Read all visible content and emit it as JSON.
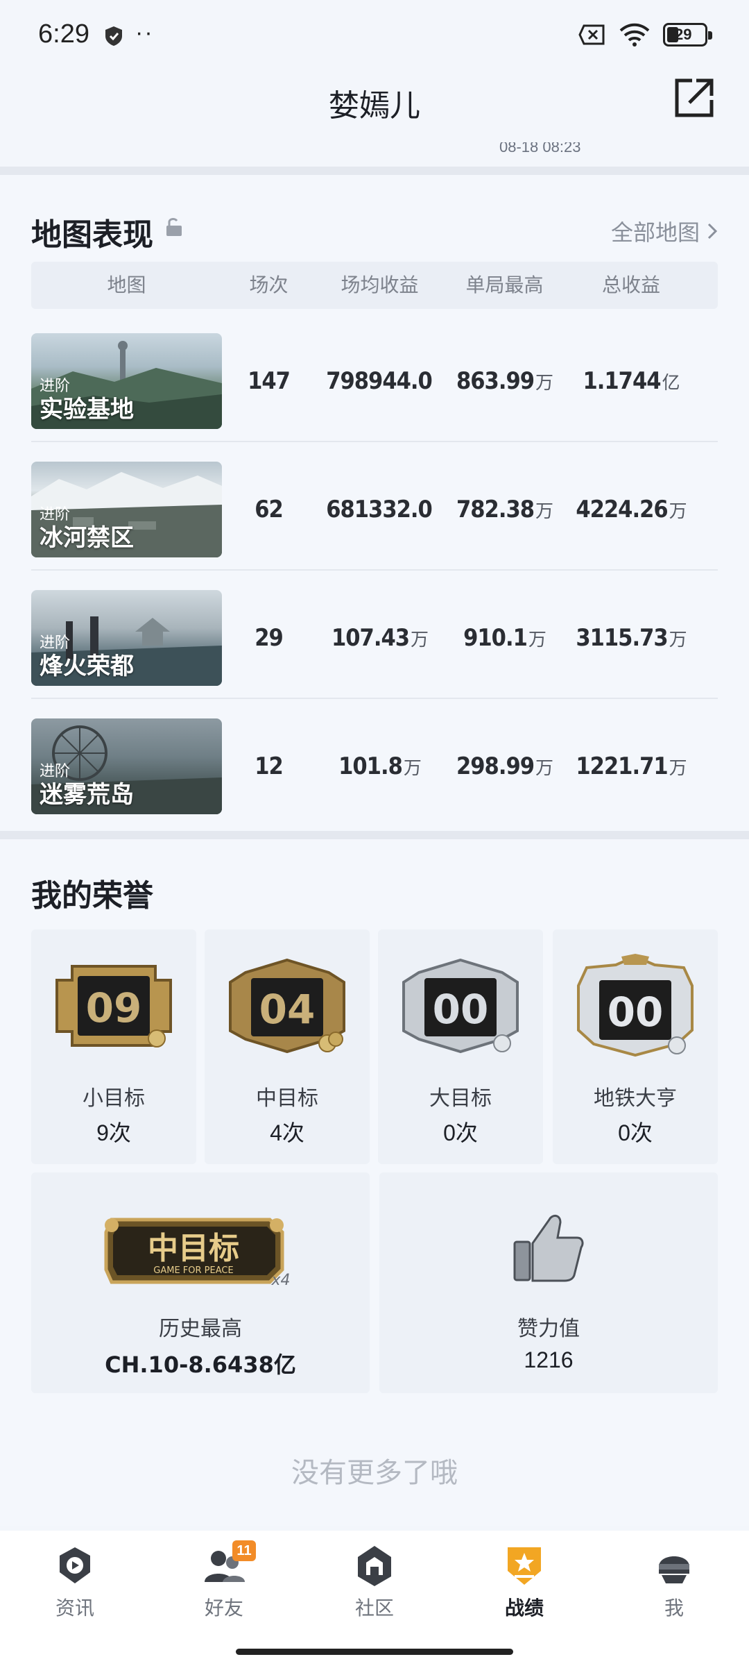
{
  "status_bar": {
    "time": "6:29",
    "dots": "··",
    "battery": "29"
  },
  "header": {
    "title": "婪嫣儿",
    "peek": "08-18 08:23"
  },
  "map_section": {
    "title": "地图表现",
    "all_maps": "全部地图",
    "columns": [
      "地图",
      "场次",
      "场均收益",
      "单局最高",
      "总收益"
    ],
    "rows": [
      {
        "tag": "进阶",
        "name": "实验基地",
        "games": "147",
        "avg": "798944.0",
        "avg_unit": "",
        "best": "863.99",
        "best_unit": "万",
        "total": "1.1744",
        "total_unit": "亿"
      },
      {
        "tag": "进阶",
        "name": "冰河禁区",
        "games": "62",
        "avg": "681332.0",
        "avg_unit": "",
        "best": "782.38",
        "best_unit": "万",
        "total": "4224.26",
        "total_unit": "万"
      },
      {
        "tag": "进阶",
        "name": "烽火荣都",
        "games": "29",
        "avg": "107.43",
        "avg_unit": "万",
        "best": "910.1",
        "best_unit": "万",
        "total": "3115.73",
        "total_unit": "万"
      },
      {
        "tag": "进阶",
        "name": "迷雾荒岛",
        "games": "12",
        "avg": "101.8",
        "avg_unit": "万",
        "best": "298.99",
        "best_unit": "万",
        "total": "1221.71",
        "total_unit": "万"
      }
    ]
  },
  "honors": {
    "title": "我的荣誉",
    "tiles": [
      {
        "badge_number": "09",
        "label": "小目标",
        "value": "9次"
      },
      {
        "badge_number": "04",
        "label": "中目标",
        "value": "4次"
      },
      {
        "badge_number": "00",
        "label": "大目标",
        "value": "0次"
      },
      {
        "badge_number": "00",
        "label": "地铁大亨",
        "value": "0次"
      }
    ],
    "history": {
      "badge_text": "中目标",
      "badge_sub": "GAME FOR PEACE",
      "multiplier": "x4",
      "label": "历史最高",
      "value": "CH.10-8.6438亿"
    },
    "likes": {
      "label": "赞力值",
      "value": "1216"
    },
    "no_more": "没有更多了哦"
  },
  "nav": {
    "items": [
      {
        "label": "资讯",
        "icon": "news-icon"
      },
      {
        "label": "好友",
        "icon": "friends-icon",
        "badge": "11"
      },
      {
        "label": "社区",
        "icon": "community-icon"
      },
      {
        "label": "战绩",
        "icon": "record-icon"
      },
      {
        "label": "我",
        "icon": "profile-icon"
      }
    ],
    "active_index": 3
  },
  "colors": {
    "accent": "#f2a623",
    "background": "#f3f6fb",
    "muted": "#8a909b"
  }
}
